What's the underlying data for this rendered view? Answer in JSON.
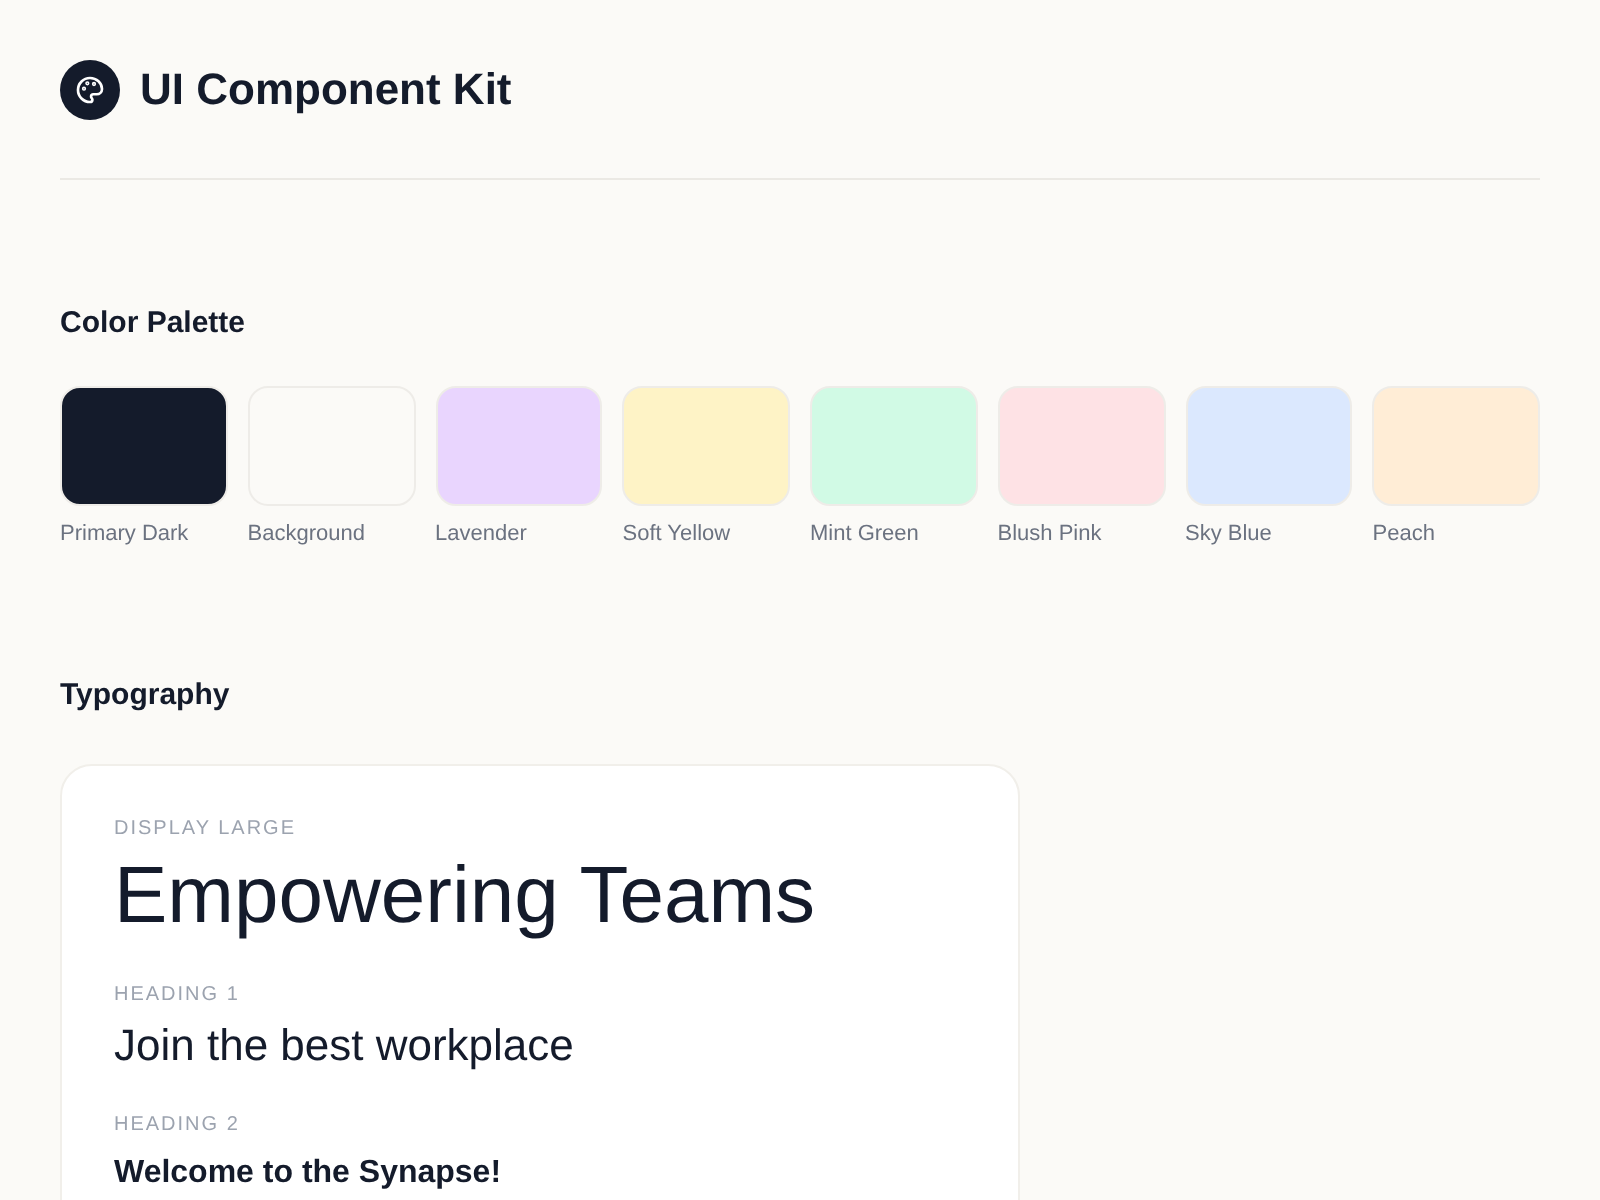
{
  "header": {
    "title": "UI Component Kit"
  },
  "palette": {
    "title": "Color Palette",
    "swatches": [
      {
        "name": "Primary Dark",
        "color": "#141b2b"
      },
      {
        "name": "Background",
        "color": "#fbfaf7"
      },
      {
        "name": "Lavender",
        "color": "#e9d5fe"
      },
      {
        "name": "Soft Yellow",
        "color": "#fef3c6"
      },
      {
        "name": "Mint Green",
        "color": "#d1fae5"
      },
      {
        "name": "Blush Pink",
        "color": "#fee2e5"
      },
      {
        "name": "Sky Blue",
        "color": "#dbe8fe"
      },
      {
        "name": "Peach",
        "color": "#ffedd6"
      }
    ]
  },
  "typography": {
    "title": "Typography",
    "samples": [
      {
        "kind": "display",
        "label": "DISPLAY LARGE",
        "text": "Empowering Teams"
      },
      {
        "kind": "h1",
        "label": "HEADING 1",
        "text": "Join the best workplace"
      },
      {
        "kind": "h2",
        "label": "HEADING 2",
        "text": "Welcome to the Synapse!"
      }
    ]
  }
}
